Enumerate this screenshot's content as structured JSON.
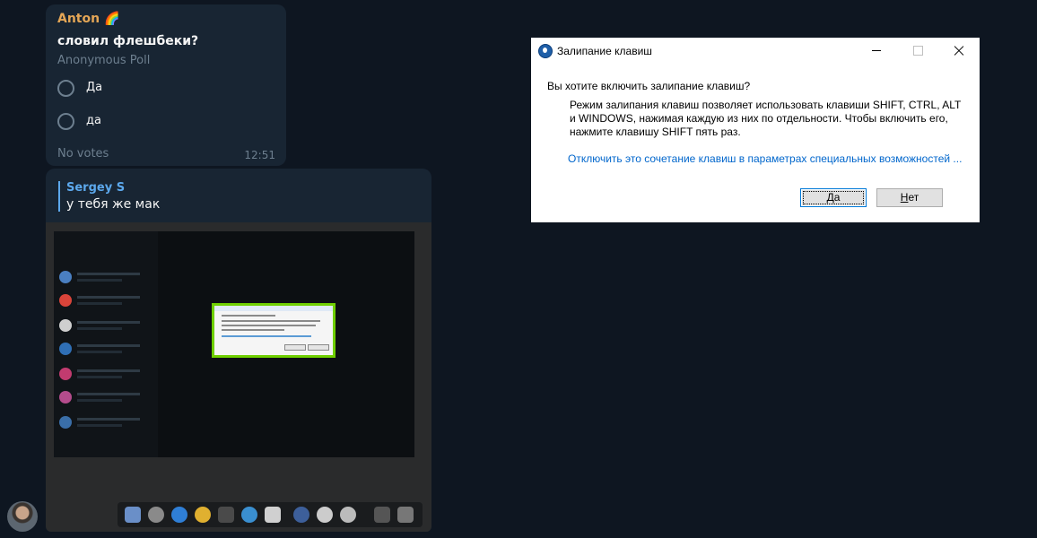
{
  "poll": {
    "sender": "Anton 🌈",
    "question": "словил флешбеки?",
    "type": "Anonymous Poll",
    "options": [
      "Да",
      "да"
    ],
    "votes": "No votes",
    "time": "12:51"
  },
  "reply_message": {
    "quote_author": "Sergey S",
    "text": "у тебя же мак"
  },
  "dialog": {
    "title": "Залипание клавиш",
    "question": "Вы хотите включить залипание клавиш?",
    "description": "Режим залипания клавиш позволяет использовать клавиши SHIFT, CTRL, ALT и WINDOWS, нажимая каждую из них по отдельности. Чтобы включить его, нажмите клавишу SHIFT пять раз.",
    "link": "Отключить это сочетание клавиш в параметрах специальных возможностей ...",
    "yes_first": "Д",
    "yes_rest": "а",
    "no_first": "Н",
    "no_rest": "ет"
  },
  "colors": {
    "background": "#0e1621",
    "bubble": "#182533",
    "sender_name": "#e4a656",
    "reply_accent": "#5ca8ec",
    "link": "#0066cc",
    "mini_dialog_border": "#6fcf00"
  },
  "icons": {
    "app": "keyboard-accessibility-icon",
    "minimize": "minimize-icon",
    "maximize": "maximize-icon",
    "close": "close-icon"
  }
}
